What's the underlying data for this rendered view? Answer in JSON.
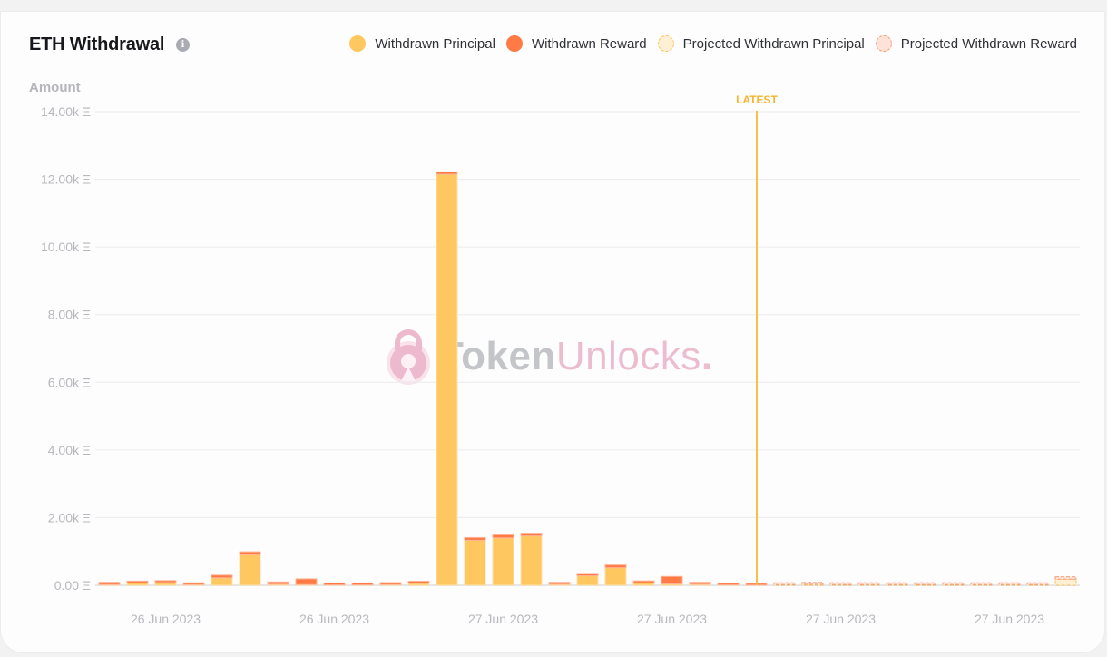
{
  "header": {
    "title": "ETH Withdrawal",
    "info_icon": "info-icon"
  },
  "legend": [
    {
      "label": "Withdrawn Principal",
      "color": "#ffc75f",
      "border": "#ffc75f",
      "dashed": false
    },
    {
      "label": "Withdrawn Reward",
      "color": "#ff7a45",
      "border": "#ff7a45",
      "dashed": false
    },
    {
      "label": "Projected Withdrawn Principal",
      "color": "#fff0d4",
      "border": "#f8c25e",
      "dashed": true
    },
    {
      "label": "Projected Withdrawn Reward",
      "color": "#ffe3d8",
      "border": "#f69a78",
      "dashed": true
    }
  ],
  "watermark": {
    "part1": "Token",
    "part2": "Unlocks",
    "dot": "."
  },
  "chart_data": {
    "type": "bar",
    "stacked": true,
    "title": "ETH Withdrawal",
    "ylabel": "Amount",
    "xlabel": "",
    "ylim": [
      0,
      14000
    ],
    "y_ticks": [
      0,
      2000,
      4000,
      6000,
      8000,
      10000,
      12000,
      14000
    ],
    "y_tick_labels": [
      "0.00 Ξ",
      "2.00k Ξ",
      "4.00k Ξ",
      "6.00k Ξ",
      "8.00k Ξ",
      "10.00k Ξ",
      "12.00k Ξ",
      "14.00k Ξ"
    ],
    "x_tick_labels": [
      {
        "index": 2,
        "label": "26 Jun 2023"
      },
      {
        "index": 8,
        "label": "26 Jun 2023"
      },
      {
        "index": 14,
        "label": "27 Jun 2023"
      },
      {
        "index": 20,
        "label": "27 Jun 2023"
      },
      {
        "index": 26,
        "label": "27 Jun 2023"
      },
      {
        "index": 32,
        "label": "27 Jun 2023"
      }
    ],
    "grid": true,
    "legend_position": "top-right",
    "marker": {
      "label": "LATEST",
      "index": 23,
      "color": "#f8c04a"
    },
    "series": [
      {
        "name": "Withdrawn Principal",
        "color": "#ffc75f",
        "values": [
          20,
          70,
          80,
          20,
          220,
          900,
          30,
          20,
          10,
          10,
          20,
          60,
          12150,
          1330,
          1400,
          1460,
          30,
          280,
          520,
          70,
          40,
          30,
          10,
          5,
          0,
          0,
          0,
          0,
          0,
          0,
          0,
          0,
          0,
          0,
          0
        ]
      },
      {
        "name": "Withdrawn Reward",
        "color": "#ff7a45",
        "values": [
          70,
          50,
          60,
          50,
          80,
          90,
          70,
          170,
          60,
          60,
          60,
          60,
          70,
          80,
          90,
          80,
          60,
          70,
          80,
          60,
          220,
          60,
          50,
          30,
          0,
          0,
          0,
          0,
          0,
          0,
          0,
          0,
          0,
          0,
          0
        ]
      },
      {
        "name": "Projected Withdrawn Principal",
        "color": "#fff0d4",
        "values": [
          0,
          0,
          0,
          0,
          0,
          0,
          0,
          0,
          0,
          0,
          0,
          0,
          0,
          0,
          0,
          0,
          0,
          0,
          0,
          0,
          0,
          0,
          0,
          0,
          20,
          30,
          20,
          20,
          20,
          20,
          20,
          20,
          20,
          20,
          180
        ]
      },
      {
        "name": "Projected Withdrawn Reward",
        "color": "#ffe3d8",
        "values": [
          0,
          0,
          0,
          0,
          0,
          0,
          0,
          0,
          0,
          0,
          0,
          0,
          0,
          0,
          0,
          0,
          0,
          0,
          0,
          0,
          0,
          0,
          0,
          0,
          40,
          50,
          40,
          40,
          40,
          40,
          40,
          40,
          40,
          40,
          70
        ]
      }
    ]
  }
}
